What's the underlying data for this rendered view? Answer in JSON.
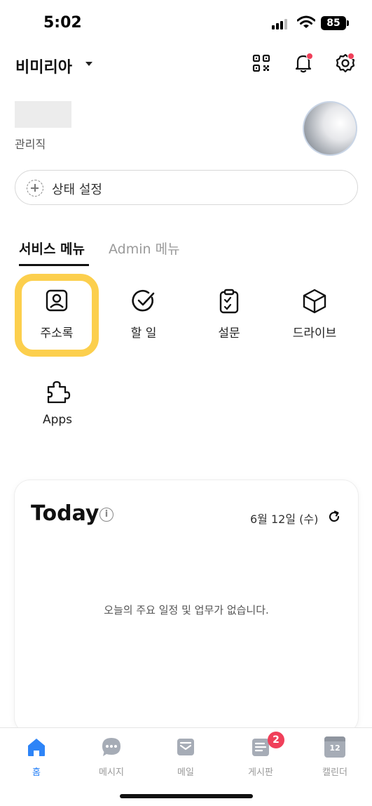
{
  "status_bar": {
    "time": "5:02",
    "battery": "85"
  },
  "header": {
    "org_name": "비미리아",
    "icons": [
      "qr-code-icon",
      "bell-icon",
      "gear-icon"
    ]
  },
  "profile": {
    "role": "관리직"
  },
  "status_setting": {
    "label": "상태 설정"
  },
  "tabs": [
    {
      "label": "서비스 메뉴",
      "active": true
    },
    {
      "label": "Admin 메뉴",
      "active": false
    }
  ],
  "menu": [
    {
      "label": "주소록",
      "icon": "contacts-icon",
      "highlighted": true
    },
    {
      "label": "할 일",
      "icon": "check-circle-icon"
    },
    {
      "label": "설문",
      "icon": "survey-clipboard-icon"
    },
    {
      "label": "드라이브",
      "icon": "cube-icon"
    },
    {
      "label": "Apps",
      "icon": "puzzle-icon"
    }
  ],
  "today": {
    "title": "Today",
    "date": "6월 12일 (수)",
    "empty_message": "오늘의 주요 일정 및 업무가 없습니다."
  },
  "bottom_nav": [
    {
      "label": "홈",
      "icon": "home-icon",
      "active": true
    },
    {
      "label": "메시지",
      "icon": "chat-bubble-icon"
    },
    {
      "label": "메일",
      "icon": "mail-icon"
    },
    {
      "label": "게시판",
      "icon": "board-icon",
      "badge": "2"
    },
    {
      "label": "캘린더",
      "icon": "calendar-icon",
      "calendar_day": "12"
    }
  ],
  "colors": {
    "accent": "#2d84f7",
    "highlight": "#fccf4d",
    "badge": "#f0405a"
  }
}
